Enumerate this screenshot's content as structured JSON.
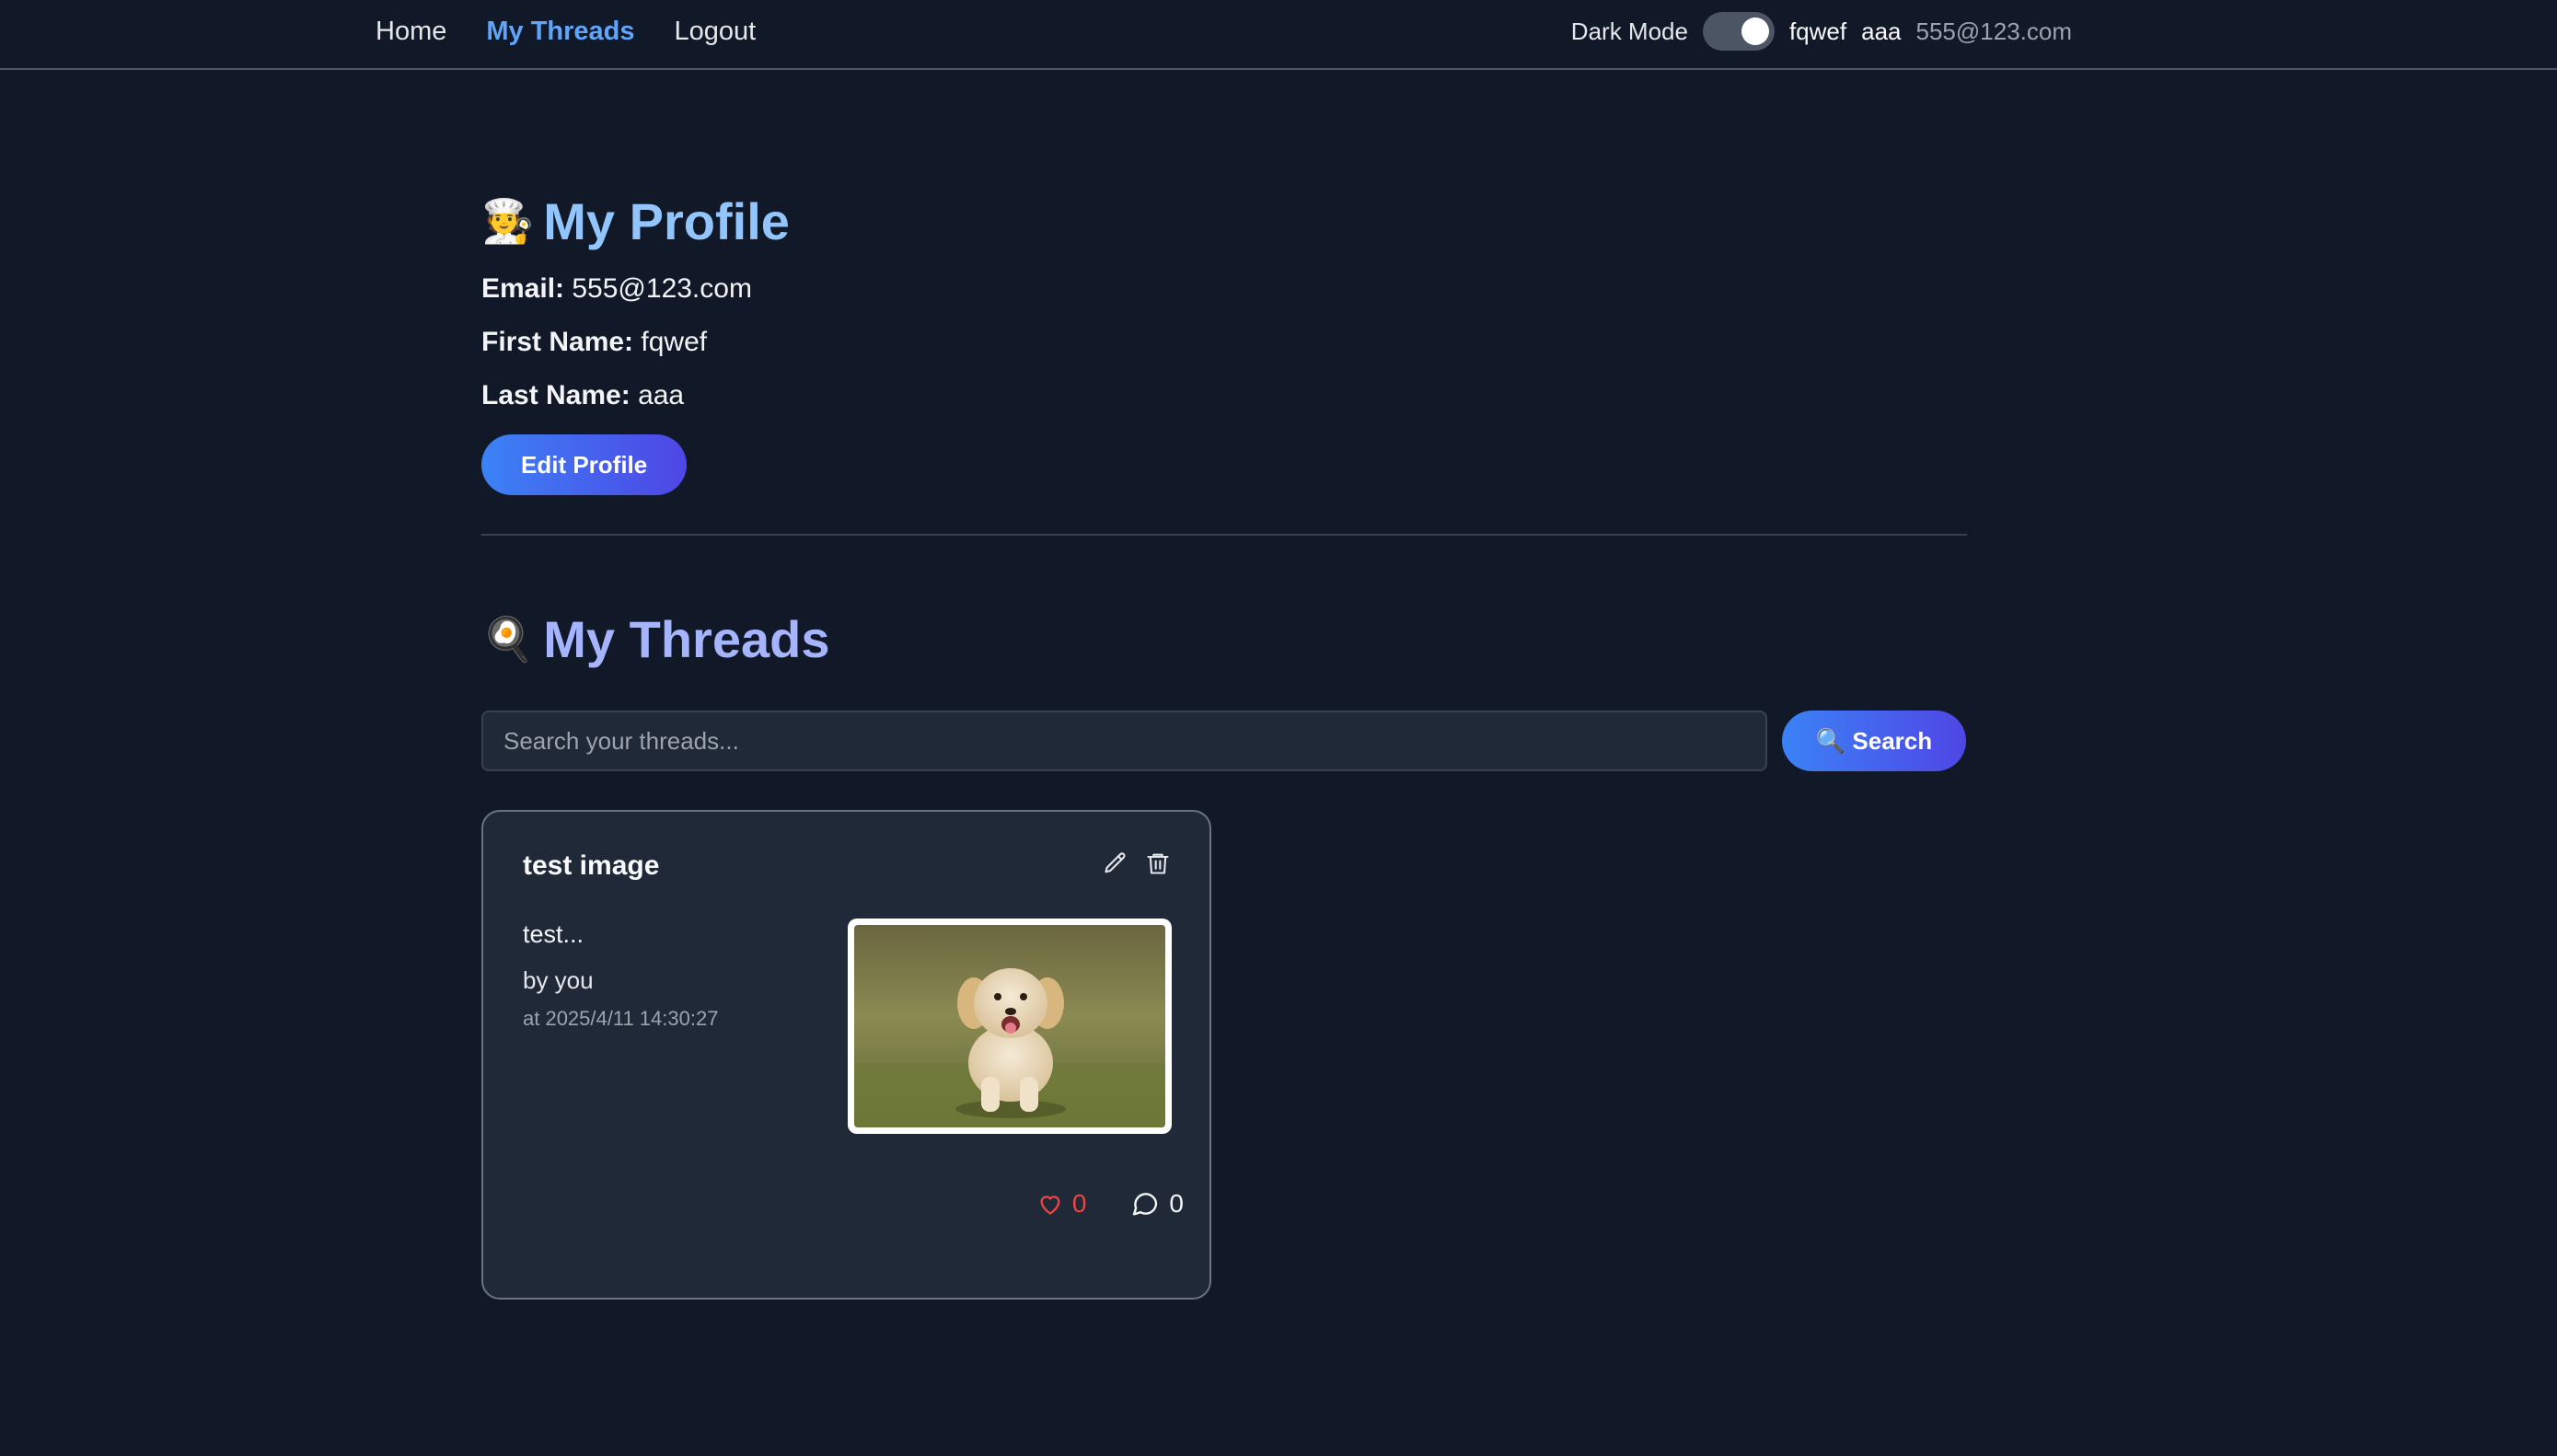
{
  "nav": {
    "home": "Home",
    "my_threads": "My Threads",
    "logout": "Logout",
    "dark_mode_label": "Dark Mode",
    "dark_mode_on": true,
    "first_name": "fqwef",
    "last_name": "aaa",
    "email": "555@123.com"
  },
  "profile": {
    "emoji": "🧑‍🍳",
    "title": "My Profile",
    "email_label": "Email:",
    "email": "555@123.com",
    "first_name_label": "First Name:",
    "first_name": "fqwef",
    "last_name_label": "Last Name:",
    "last_name": "aaa",
    "edit_button": "Edit Profile"
  },
  "threads": {
    "emoji": "🍳",
    "title": "My Threads",
    "search_placeholder": "Search your threads...",
    "search_button": "🔍 Search",
    "items": [
      {
        "title": "test image",
        "snippet": "test...",
        "author": "by you",
        "time": "at 2025/4/11 14:30:27",
        "image_subject": "puppy",
        "likes": "0",
        "comments": "0"
      }
    ]
  },
  "colors": {
    "background": "#111827",
    "accent_blue": "#60a5fa",
    "title_blue": "#93c5fd",
    "title_indigo": "#a5b4fc",
    "like_red": "#ef4444"
  }
}
